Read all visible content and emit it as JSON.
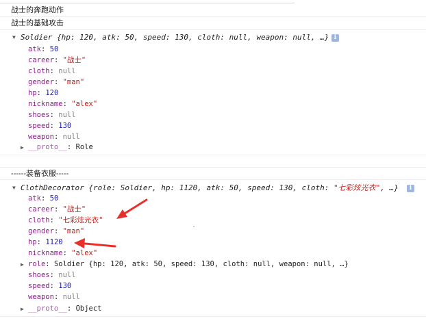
{
  "logs": {
    "line1": "战士的奔跑动作",
    "line2": "战士的基础攻击",
    "line3": "------装备衣服-----"
  },
  "soldier": {
    "summary_name": "Soldier",
    "summary_body": "{hp: 120, atk: 50, speed: 130, cloth: null, weapon: null, …}",
    "props": [
      {
        "key": "atk",
        "value": "50",
        "kind": "num"
      },
      {
        "key": "career",
        "value": "\"战士\"",
        "kind": "str"
      },
      {
        "key": "cloth",
        "value": "null",
        "kind": "nul"
      },
      {
        "key": "gender",
        "value": "\"man\"",
        "kind": "str"
      },
      {
        "key": "hp",
        "value": "120",
        "kind": "num"
      },
      {
        "key": "nickname",
        "value": "\"alex\"",
        "kind": "str"
      },
      {
        "key": "shoes",
        "value": "null",
        "kind": "nul"
      },
      {
        "key": "speed",
        "value": "130",
        "kind": "num"
      },
      {
        "key": "weapon",
        "value": "null",
        "kind": "nul"
      }
    ],
    "proto_key": "__proto__",
    "proto_value": "Role"
  },
  "decorator": {
    "summary_name": "ClothDecorator",
    "summary_pre": "{role: Soldier, hp: 1120, atk: 50, speed: 130, cloth: ",
    "summary_cloth": "\"七彩炫光衣\"",
    "summary_post": ", …}",
    "props": [
      {
        "key": "atk",
        "value": "50",
        "kind": "num"
      },
      {
        "key": "career",
        "value": "\"战士\"",
        "kind": "str"
      },
      {
        "key": "cloth",
        "value": "\"七彩炫光衣\"",
        "kind": "str"
      },
      {
        "key": "gender",
        "value": "\"man\"",
        "kind": "str"
      },
      {
        "key": "hp",
        "value": "1120",
        "kind": "num"
      },
      {
        "key": "nickname",
        "value": "\"alex\"",
        "kind": "str"
      }
    ],
    "role_key": "role",
    "role_value": "Soldier {hp: 120, atk: 50, speed: 130, cloth: null, weapon: null, …}",
    "props2": [
      {
        "key": "shoes",
        "value": "null",
        "kind": "nul"
      },
      {
        "key": "speed",
        "value": "130",
        "kind": "num"
      },
      {
        "key": "weapon",
        "value": "null",
        "kind": "nul"
      }
    ],
    "proto_key": "__proto__",
    "proto_value": "Object"
  },
  "icons": {
    "expand": "triangle-down",
    "collapse": "triangle-right",
    "info": "info-icon"
  },
  "colors": {
    "annotation_arrow": "#e8302a",
    "key": "#8b1e8b",
    "number": "#1a1aa6",
    "string": "#c41a16"
  }
}
